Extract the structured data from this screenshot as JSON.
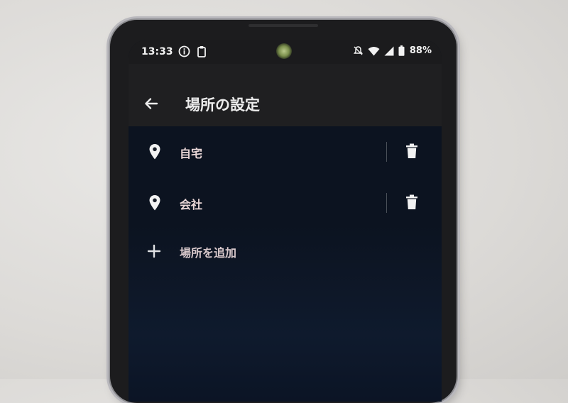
{
  "status_bar": {
    "time": "13:33",
    "battery": "88%",
    "icons": [
      "info-icon",
      "clipboard-icon",
      "mute-icon",
      "wifi-icon",
      "signal-icon",
      "battery-icon"
    ]
  },
  "app_bar": {
    "title": "場所の設定",
    "back_icon": "back-arrow-icon"
  },
  "locations": [
    {
      "label": "自宅",
      "icon": "location-pin-icon",
      "action_icon": "trash-icon"
    },
    {
      "label": "会社",
      "icon": "location-pin-icon",
      "action_icon": "trash-icon"
    }
  ],
  "add_location": {
    "label": "場所を追加",
    "icon": "plus-icon"
  },
  "colors": {
    "background": "#0c1320",
    "app_bar": "#1f1f21",
    "text_primary": "#ececec",
    "list_text": "#ead7d7"
  }
}
